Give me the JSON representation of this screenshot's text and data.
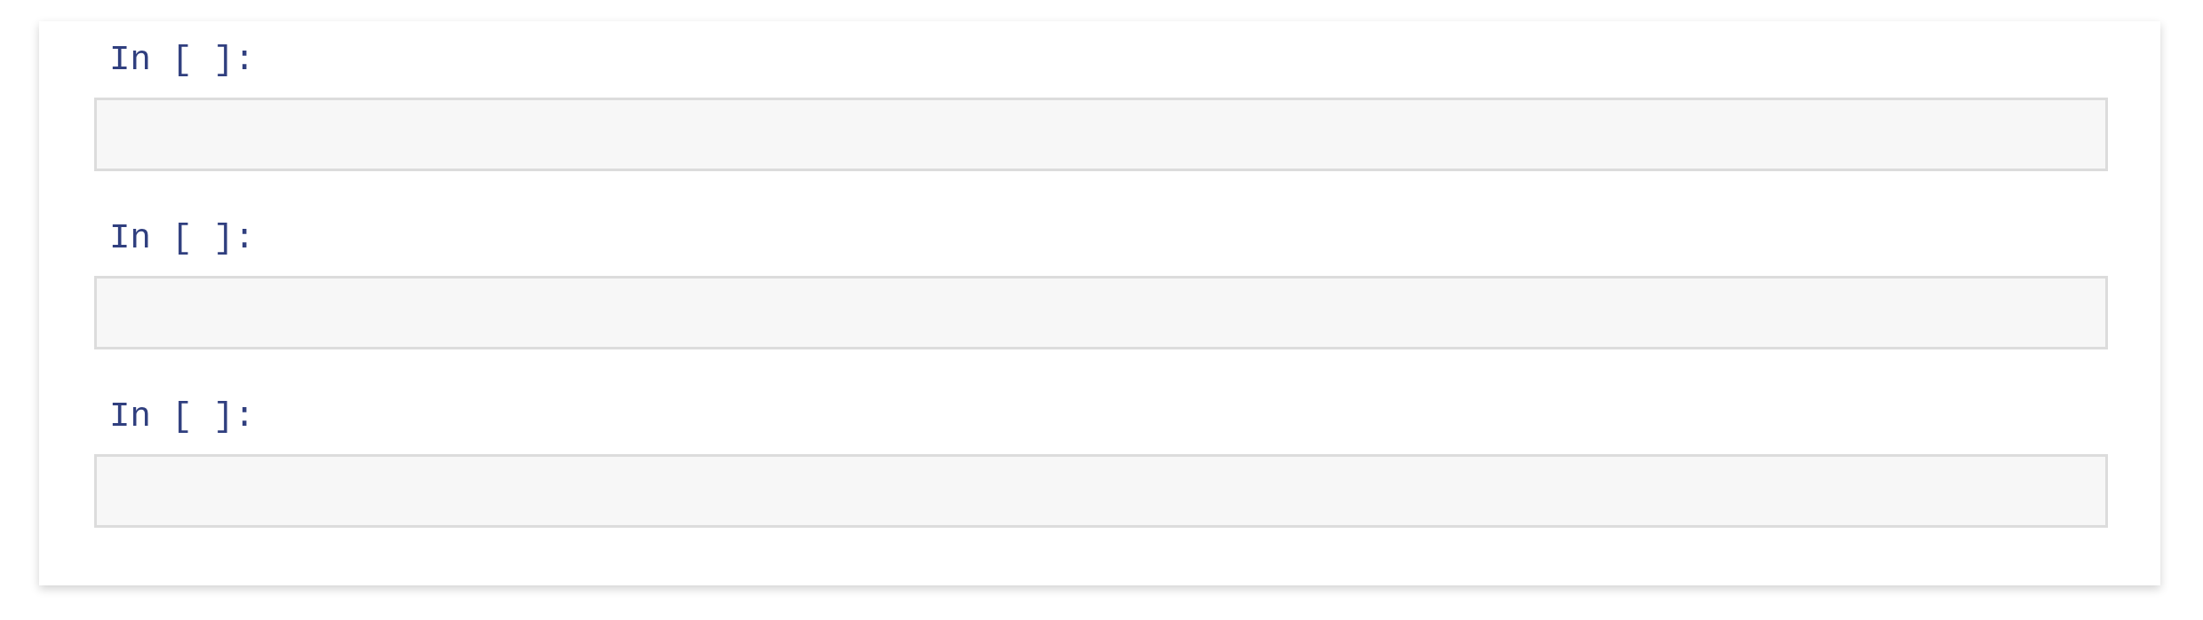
{
  "cells": [
    {
      "prompt": "In [ ]:"
    },
    {
      "prompt": "In [ ]:"
    },
    {
      "prompt": "In [ ]:"
    }
  ]
}
